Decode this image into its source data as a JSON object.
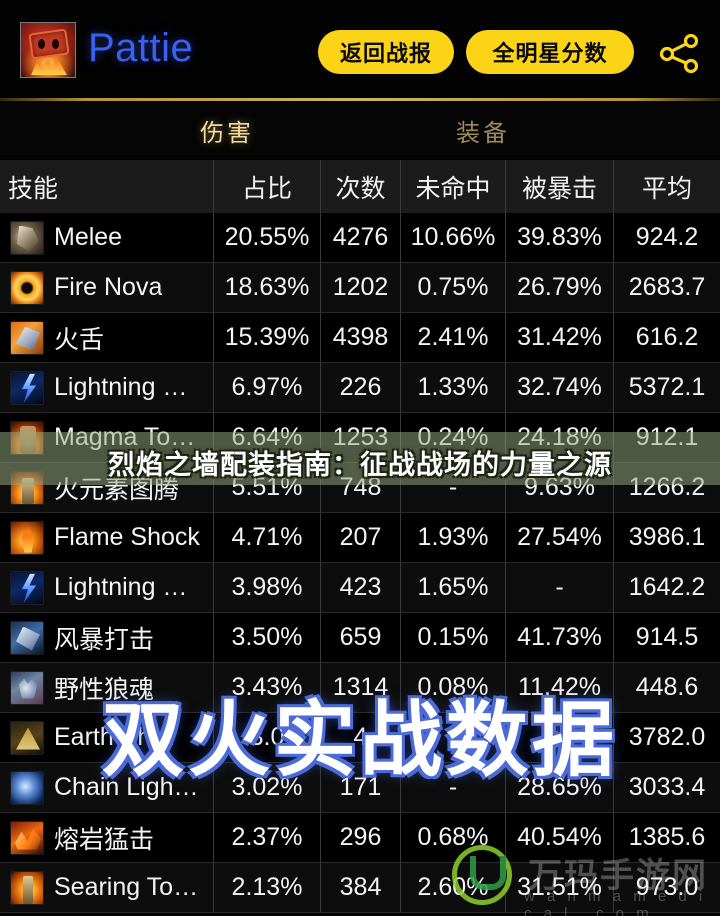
{
  "header": {
    "player_name": "Pattie",
    "avatar_icon": "shaman-totem-avatar",
    "buttons": [
      {
        "id": "back-to-report",
        "label": "返回战报"
      },
      {
        "id": "all-star-score",
        "label": "全明星分数"
      }
    ],
    "share_icon": "share-icon"
  },
  "tabs": [
    {
      "label": "伤害",
      "active": true
    },
    {
      "label": "装备",
      "active": false
    }
  ],
  "table": {
    "columns": [
      "技能",
      "占比",
      "次数",
      "未命中",
      "被暴击",
      "平均"
    ],
    "rows": [
      {
        "icon": "melee-icon",
        "skill": "Melee",
        "pct": "20.55%",
        "count": "4276",
        "miss": "10.66%",
        "crit": "39.83%",
        "avg": "924.2"
      },
      {
        "icon": "fire-nova-icon",
        "skill": "Fire Nova",
        "pct": "18.63%",
        "count": "1202",
        "miss": "0.75%",
        "crit": "26.79%",
        "avg": "2683.7"
      },
      {
        "icon": "flametongue-icon",
        "skill": "火舌",
        "pct": "15.39%",
        "count": "4398",
        "miss": "2.41%",
        "crit": "31.42%",
        "avg": "616.2"
      },
      {
        "icon": "lightning-icon",
        "skill": "Lightning …",
        "pct": "6.97%",
        "count": "226",
        "miss": "1.33%",
        "crit": "32.74%",
        "avg": "5372.1"
      },
      {
        "icon": "magma-totem-icon",
        "skill": "Magma To…",
        "pct": "6.64%",
        "count": "1253",
        "miss": "0.24%",
        "crit": "24.18%",
        "avg": "912.1"
      },
      {
        "icon": "fire-totem-icon",
        "skill": "火元素图腾",
        "pct": "5.51%",
        "count": "748",
        "miss": "-",
        "crit": "9.63%",
        "avg": "1266.2"
      },
      {
        "icon": "flame-shock-icon",
        "skill": "Flame Shock",
        "pct": "4.71%",
        "count": "207",
        "miss": "1.93%",
        "crit": "27.54%",
        "avg": "3986.1"
      },
      {
        "icon": "lightning-icon",
        "skill": "Lightning …",
        "pct": "3.98%",
        "count": "423",
        "miss": "1.65%",
        "crit": "-",
        "avg": "1642.2"
      },
      {
        "icon": "stormstrike-icon",
        "skill": "风暴打击",
        "pct": "3.50%",
        "count": "659",
        "miss": "0.15%",
        "crit": "41.73%",
        "avg": "914.5"
      },
      {
        "icon": "feral-wolves-icon",
        "skill": "野性狼魂",
        "pct": "3.43%",
        "count": "1314",
        "miss": "0.08%",
        "crit": "11.42%",
        "avg": "448.6"
      },
      {
        "icon": "earth-shock-icon",
        "skill": "Earth Sh…",
        "pct": "3.0",
        "count": "4",
        "miss": "",
        "crit": "",
        "avg": "3782.0"
      },
      {
        "icon": "chain-lightning-icon",
        "skill": "Chain Ligh…",
        "pct": "3.02%",
        "count": "171",
        "miss": "-",
        "crit": "28.65%",
        "avg": "3033.4"
      },
      {
        "icon": "lava-lash-icon",
        "skill": "熔岩猛击",
        "pct": "2.37%",
        "count": "296",
        "miss": "0.68%",
        "crit": "40.54%",
        "avg": "1385.6"
      },
      {
        "icon": "searing-totem-icon",
        "skill": "Searing To…",
        "pct": "2.13%",
        "count": "384",
        "miss": "2.60%",
        "crit": "31.51%",
        "avg": "973.0"
      }
    ]
  },
  "overlays": {
    "banner_text": "烈焰之墙配装指南：征战战场的力量之源",
    "big_text": "双火实战数据",
    "watermark_cn": "万玛手游网",
    "watermark_en": "w a n m a m e d i c a l . c o m",
    "watermark_logo": "u-circle-logo"
  },
  "colors": {
    "accent_yellow": "#fbd417",
    "player_blue": "#3b5ff0",
    "tab_gold": "#f3dd9a",
    "tab_gold_dim": "#9b8b5c",
    "banner_olive": "#96a87e",
    "bigtext_outline": "#4a6bd8",
    "logo_green": "#8fd12c"
  }
}
